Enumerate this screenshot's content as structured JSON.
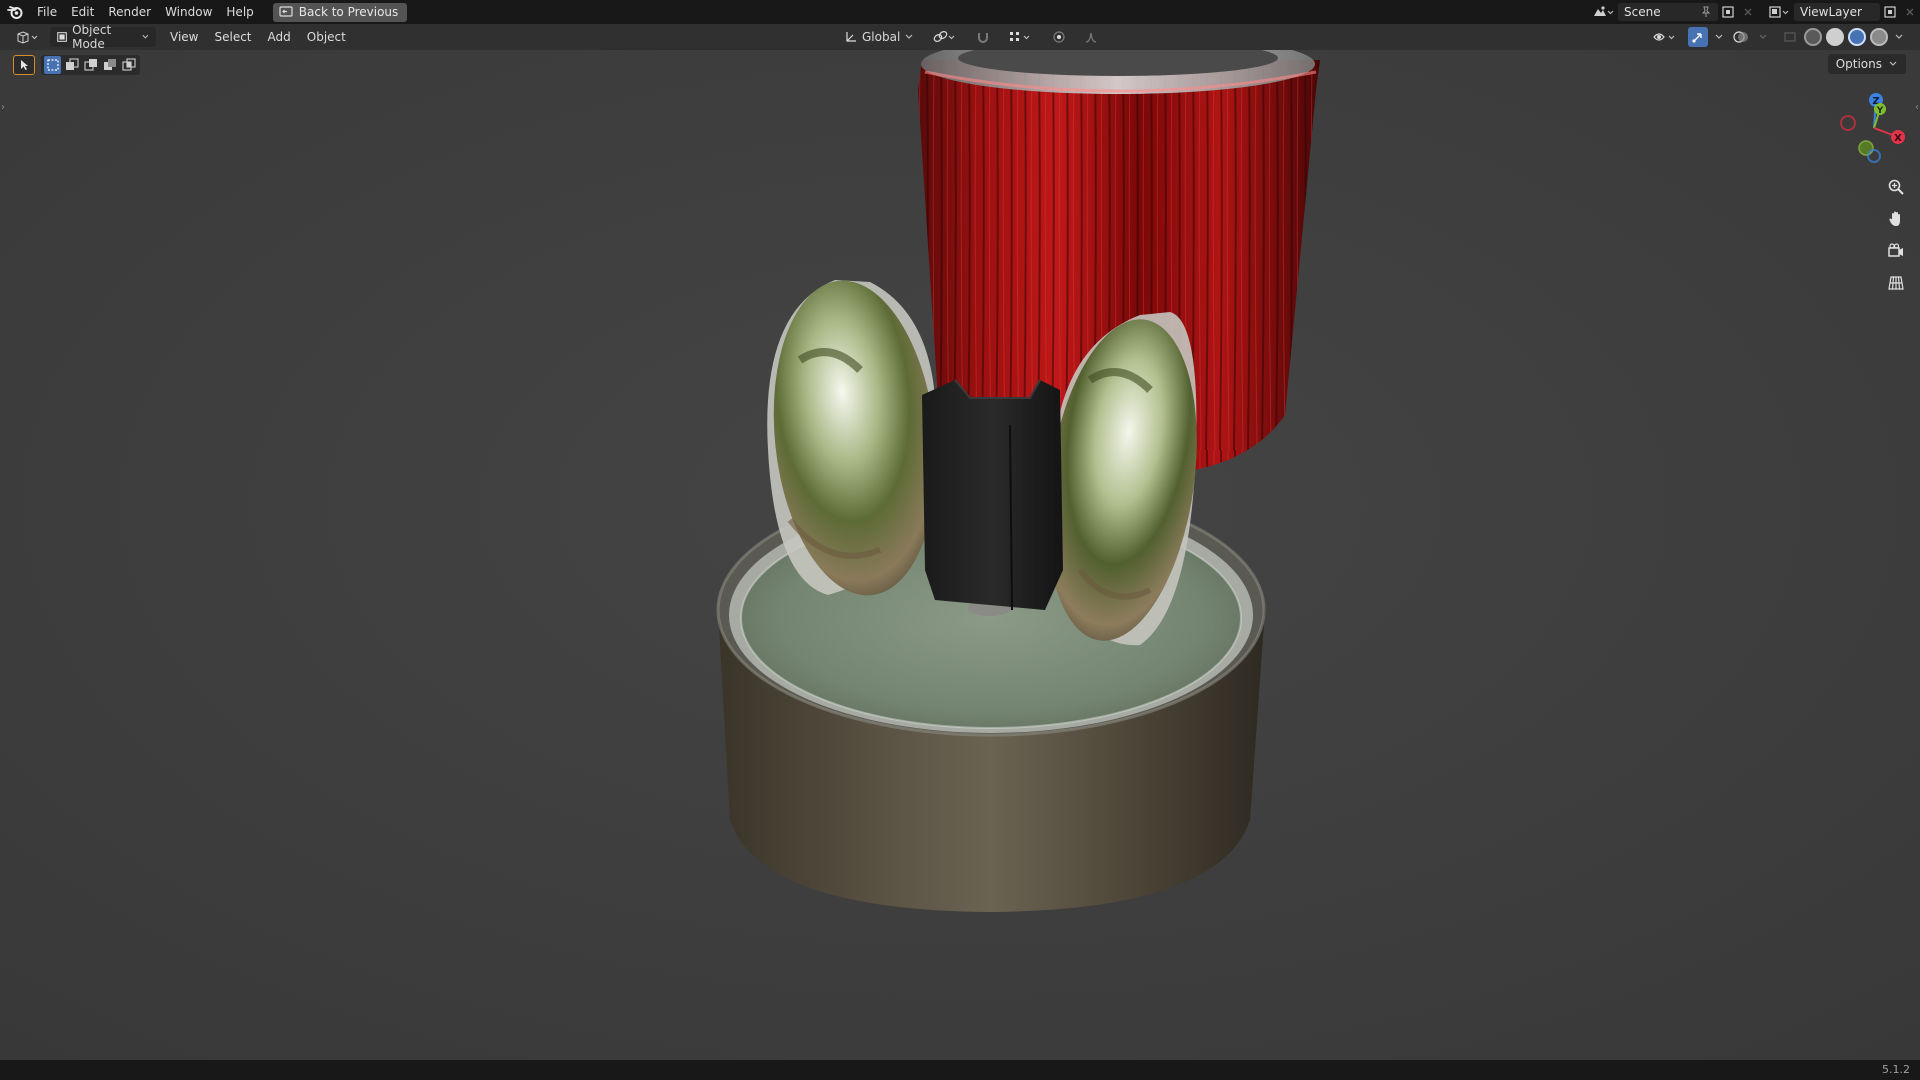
{
  "topbar": {
    "menus": [
      "File",
      "Edit",
      "Render",
      "Window",
      "Help"
    ],
    "back_button": "Back to Previous",
    "scene_name": "Scene",
    "view_layer": "ViewLayer"
  },
  "header": {
    "mode": "Object Mode",
    "menus": [
      "View",
      "Select",
      "Add",
      "Object"
    ],
    "transform_orientation": "Global"
  },
  "viewport": {
    "options_label": "Options",
    "gizmo_axes": [
      "Z",
      "Y",
      "X"
    ]
  },
  "statusbar": {
    "version": "5.1.2"
  },
  "colors": {
    "topbar_bg": "#181818",
    "header_bg": "#303030",
    "viewport_bg": "#3d3d3d",
    "axis_x": "#e0344a",
    "axis_y": "#7fbf2f",
    "axis_z": "#3a83e0",
    "accent": "#4772b3"
  }
}
